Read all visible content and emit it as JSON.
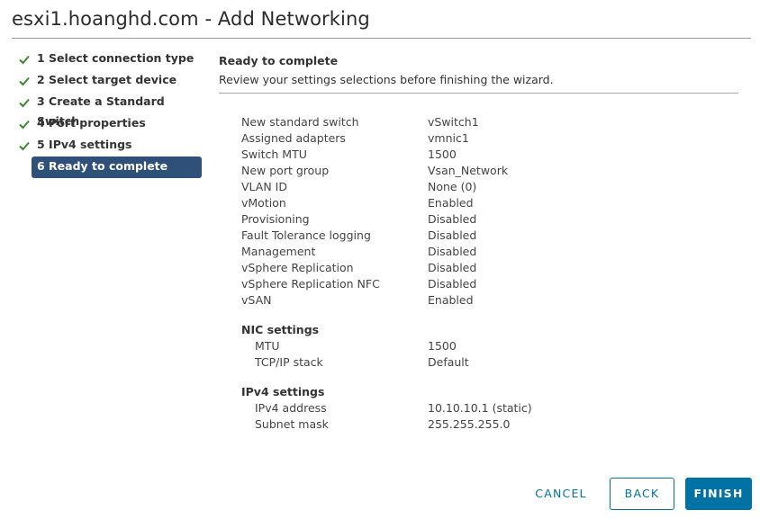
{
  "window": {
    "title": "esxi1.hoanghd.com - Add Networking"
  },
  "steps": [
    {
      "label": "1 Select connection type",
      "done": true
    },
    {
      "label": "2 Select target device",
      "done": true
    },
    {
      "label": "3 Create a Standard Switch",
      "done": true
    },
    {
      "label": "4 Port properties",
      "done": true
    },
    {
      "label": "5 IPv4 settings",
      "done": true
    },
    {
      "label": "6 Ready to complete",
      "done": false,
      "active": true
    }
  ],
  "main": {
    "title": "Ready to complete",
    "description": "Review your settings selections before finishing the wizard."
  },
  "summary": [
    {
      "label": "New standard switch",
      "value": "vSwitch1"
    },
    {
      "label": "Assigned adapters",
      "value": "vmnic1"
    },
    {
      "label": "Switch MTU",
      "value": "1500"
    },
    {
      "label": "New port group",
      "value": "Vsan_Network"
    },
    {
      "label": "VLAN ID",
      "value": "None (0)"
    },
    {
      "label": "vMotion",
      "value": "Enabled"
    },
    {
      "label": "Provisioning",
      "value": "Disabled"
    },
    {
      "label": "Fault Tolerance logging",
      "value": "Disabled"
    },
    {
      "label": "Management",
      "value": "Disabled"
    },
    {
      "label": "vSphere Replication",
      "value": "Disabled"
    },
    {
      "label": "vSphere Replication NFC",
      "value": "Disabled"
    },
    {
      "label": "vSAN",
      "value": "Enabled"
    }
  ],
  "nic_settings": {
    "heading": "NIC settings",
    "rows": [
      {
        "label": "MTU",
        "value": "1500"
      },
      {
        "label": "TCP/IP stack",
        "value": "Default"
      }
    ]
  },
  "ipv4_settings": {
    "heading": "IPv4 settings",
    "rows": [
      {
        "label": "IPv4 address",
        "value": "10.10.10.1 (static)"
      },
      {
        "label": "Subnet mask",
        "value": "255.255.255.0"
      }
    ]
  },
  "buttons": {
    "cancel": "CANCEL",
    "back": "BACK",
    "finish": "FINISH"
  },
  "colors": {
    "check": "#3c8a2e",
    "active_step_bg": "#2f5179",
    "primary": "#0072a3"
  }
}
